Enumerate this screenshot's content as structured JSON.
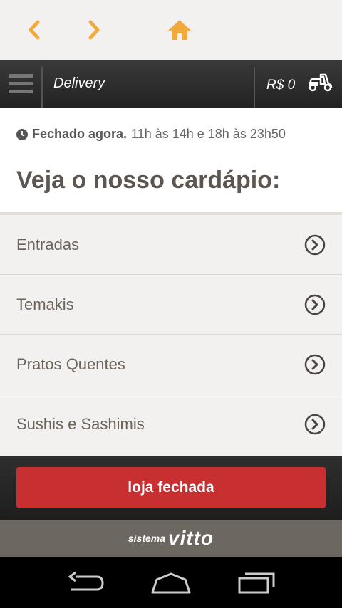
{
  "browser": {
    "back_icon": "chevron-left-icon",
    "forward_icon": "chevron-right-icon",
    "home_icon": "home-icon",
    "accent": "#f2a93b"
  },
  "header": {
    "title": "Delivery",
    "cart_total": "R$ 0"
  },
  "info": {
    "status": "Fechado agora.",
    "hours": "11h às 14h e 18h às 23h50",
    "heading": "Veja o nosso cardápio:"
  },
  "categories": [
    {
      "label": "Entradas"
    },
    {
      "label": "Temakis"
    },
    {
      "label": "Pratos Quentes"
    },
    {
      "label": "Sushis e Sashimis"
    }
  ],
  "footer": {
    "button_label": "loja fechada",
    "button_color": "#c82f31",
    "brand_small": "sistema",
    "brand_big": "vitto"
  }
}
